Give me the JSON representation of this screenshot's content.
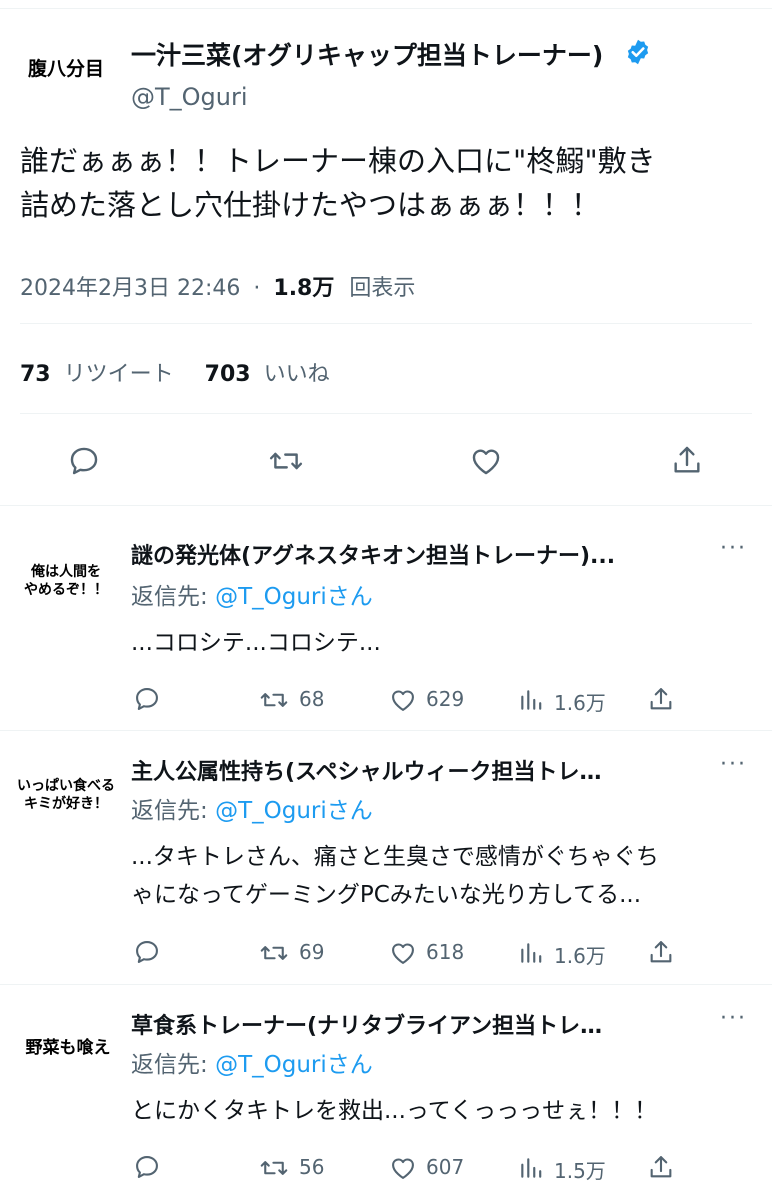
{
  "colors": {
    "accent": "#1d9bf0",
    "text": "#0f1419",
    "secondary": "#536471",
    "divider": "#eff3f4"
  },
  "main_tweet": {
    "avatar_text": "腹八分目",
    "display_name": "一汁三菜(オグリキャップ担当トレーナー)",
    "verified_icon": "verified-badge-icon",
    "handle": "@T_Oguri",
    "text_line1": "誰だぁぁぁ！！トレーナー棟の入口に\"柊鰯\"敷き",
    "text_line2": "詰めた落とし穴仕掛けたやつはぁぁぁ！！！",
    "timestamp": "2024年2月3日 22:46",
    "separator": "·",
    "views_count": "1.8万",
    "views_label": "回表示",
    "retweet_count": "73",
    "retweet_label": "リツイート",
    "like_count": "703",
    "like_label": "いいね",
    "actions": [
      "reply-icon",
      "retweet-icon",
      "like-icon",
      "share-icon"
    ]
  },
  "replies": [
    {
      "avatar_line1": "俺は人間を",
      "avatar_line2": "やめるぞ！！",
      "display_name": "謎の発光体(アグネスタキオン担当トレーナー)...",
      "reply_prefix": "返信先: ",
      "mention": "@T_Oguri",
      "mention_suffix": "さん",
      "text_line1": "...コロシテ...コロシテ...",
      "text_line2": "",
      "retweets": "68",
      "likes": "629",
      "views": "1.6万"
    },
    {
      "avatar_line1": "いっぱい食べる",
      "avatar_line2": "キミが好き！",
      "display_name": "主人公属性持ち(スペシャルウィーク担当トレ…",
      "reply_prefix": "返信先: ",
      "mention": "@T_Oguri",
      "mention_suffix": "さん",
      "text_line1": "...タキトレさん、痛さと生臭さで感情がぐちゃぐち",
      "text_line2": "ゃになってゲーミングPCみたいな光り方してる...",
      "retweets": "69",
      "likes": "618",
      "views": "1.6万"
    },
    {
      "avatar_line1": "野菜も喰え",
      "avatar_line2": "",
      "display_name": "草食系トレーナー(ナリタブライアン担当トレ…",
      "reply_prefix": "返信先: ",
      "mention": "@T_Oguri",
      "mention_suffix": "さん",
      "text_line1": "とにかくタキトレを救出...ってくっっっせぇ！！！",
      "text_line2": "",
      "retweets": "56",
      "likes": "607",
      "views": "1.5万"
    }
  ],
  "more_label": "···"
}
